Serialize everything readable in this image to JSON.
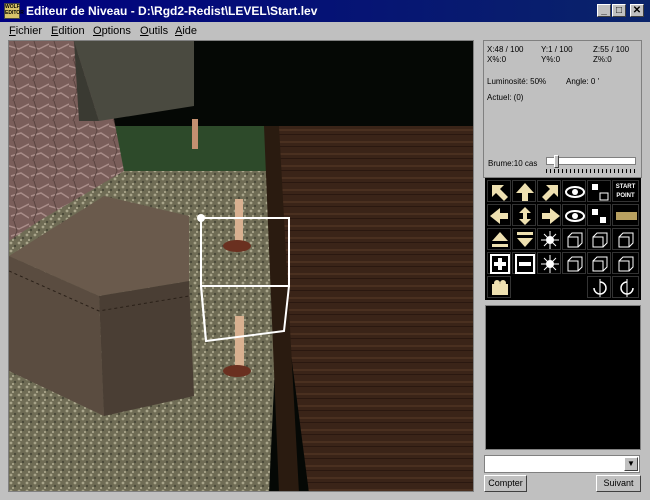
{
  "window": {
    "title": "Editeur de Niveau - D:\\Rgd2-Redist\\LEVEL\\Start.lev",
    "app_icon_text": "WOLF EDITOR",
    "minimize_glyph": "_",
    "maximize_glyph": "□",
    "close_glyph": "✕"
  },
  "menu": {
    "items": [
      {
        "first": "F",
        "rest": "ichier"
      },
      {
        "first": "E",
        "rest": "dition"
      },
      {
        "first": "O",
        "rest": "ptions"
      },
      {
        "first": "O",
        "rest": "utils"
      },
      {
        "first": "A",
        "rest": "ide"
      }
    ]
  },
  "info": {
    "x_coord": "X:48 / 100",
    "y_coord": "Y:1 / 100",
    "z_coord": "Z:55 / 100",
    "x_pct": "X%:0",
    "y_pct": "Y%:0",
    "z_pct": "Z%:0",
    "brightness": "Luminosité: 50%",
    "angle": "Angle: 0 '",
    "current": "Actuel: (0)",
    "fog_label": "Brume:10 cas",
    "fog_level": 0.08
  },
  "tools": {
    "start_point_label": "START POINT",
    "icons": [
      "arrow-nw-icon",
      "arrow-up-icon",
      "arrow-ne-icon",
      "eye-icon",
      "select-icon",
      "arrow-left-icon",
      "arrow-cross-icon",
      "arrow-right-icon",
      "eye-2-icon",
      "copy-icon",
      "up-plane-icon",
      "down-plane-icon",
      "sun-icon",
      "cube-nw-icon",
      "cube-n-icon",
      "cube-ne-icon",
      "plus-icon",
      "minus-icon",
      "sun-2-icon",
      "cube-sw-icon",
      "cube-s-icon",
      "cube-se-icon",
      "camera-icon",
      "rotate-left-icon",
      "rotate-right-icon"
    ]
  },
  "bottom": {
    "combo_value": "",
    "count_button": "Compter",
    "next_button": "Suivant",
    "dropdown_glyph": "▼"
  }
}
